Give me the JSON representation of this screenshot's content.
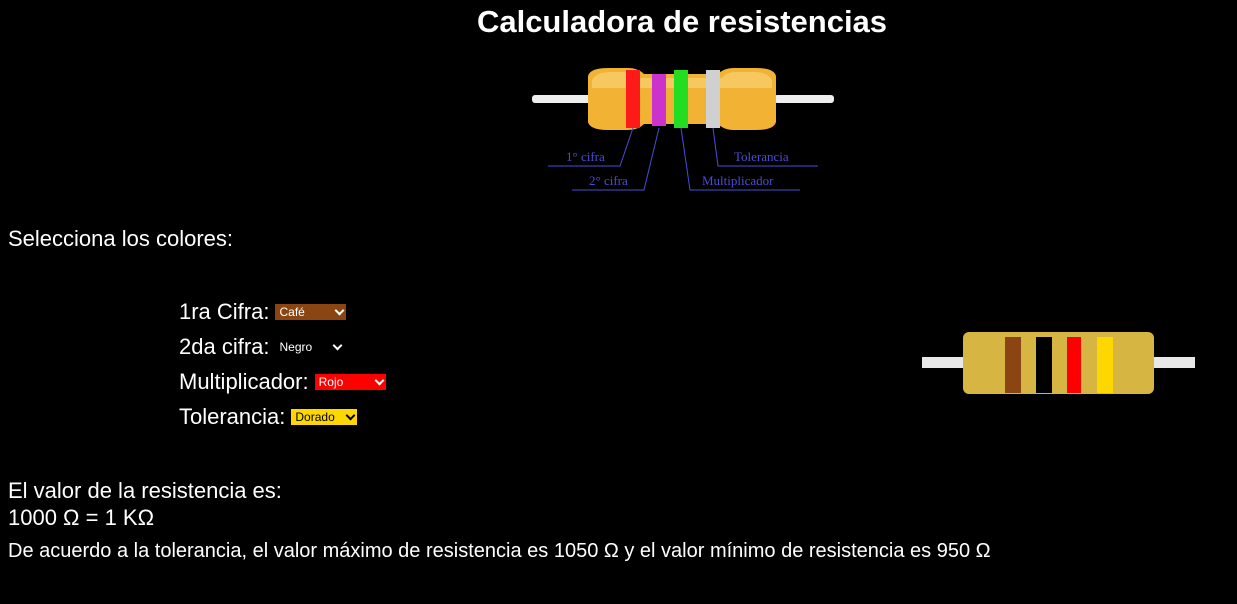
{
  "header": {
    "title": "Calculadora de resistencias"
  },
  "diagram": {
    "labels": {
      "first_digit": "1° cifra",
      "second_digit": "2° cifra",
      "multiplier": "Multiplicador",
      "tolerance": "Tolerancia"
    },
    "band_colors": [
      "#ff1a1a",
      "#cc33cc",
      "#22dd22",
      "#d0d0d0"
    ],
    "body_color": "#f2b233",
    "label_color": "#4b4bd6"
  },
  "prompt": "Selecciona los colores:",
  "form": {
    "digit1": {
      "label": "1ra Cifra:",
      "value": "Café",
      "color": "#8b4513"
    },
    "digit2": {
      "label": "2da cifra:",
      "value": "Negro",
      "color": "#000000"
    },
    "multiplier": {
      "label": "Multiplicador:",
      "value": "Rojo",
      "color": "#ff0000"
    },
    "tolerance": {
      "label": "Tolerancia:",
      "value": "Dorado",
      "color": "#ffd700"
    }
  },
  "preview": {
    "body_color": "#d6b542",
    "lead_color": "#e8e8e8",
    "band_colors": [
      "#8b4513",
      "#000000",
      "#ff0000",
      "#ffd700"
    ]
  },
  "result": {
    "label": "El valor de la resistencia es:",
    "value": "1000 Ω = 1 KΩ",
    "tolerance_text": "De acuerdo a la tolerancia, el valor máximo de resistencia es 1050 Ω y el valor mínimo de resistencia es 950 Ω"
  }
}
